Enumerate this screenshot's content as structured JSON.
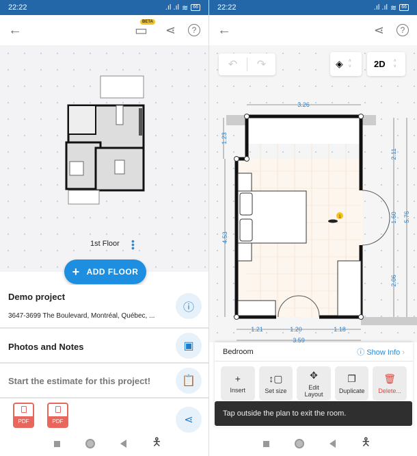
{
  "status_bar": {
    "time": "22:22",
    "battery": "66"
  },
  "left": {
    "beta_badge": "BETA",
    "floor_label": "1st Floor",
    "add_floor_label": "ADD FLOOR",
    "project": {
      "title": "Demo project",
      "address": "3647-3699 The Boulevard, Montréal, Québec, ..."
    },
    "photos_label": "Photos and Notes",
    "estimate_label": "Start the estimate for this project!",
    "pdf_labels": [
      "PDF",
      "PDF"
    ]
  },
  "right": {
    "view_mode": "2D",
    "dimensions": {
      "top": "3.26",
      "left_upper": "1.23",
      "left": "4.53",
      "right_upper": "2.11",
      "right_door": "1.60",
      "right_lower": "2.06",
      "right_total": "5.76",
      "bottom_left": "1.21",
      "bottom_door": "1.20",
      "bottom_right": "1.18",
      "bottom_total": "3.59"
    },
    "marker_badge": "1",
    "room_name": "Bedroom",
    "show_info": "Show Info",
    "actions": [
      {
        "label": "Insert",
        "icon": "plus-icon"
      },
      {
        "label": "Set size",
        "icon": "resize-icon"
      },
      {
        "label": "Edit Layout",
        "icon": "move-icon"
      },
      {
        "label": "Duplicate",
        "icon": "copy-icon"
      },
      {
        "label": "Delete...",
        "icon": "trash-icon"
      }
    ],
    "toast": "Tap outside the plan to exit the room.",
    "colors": {
      "accent": "#1d8ee0",
      "delete": "#e0453a",
      "status_bar": "#2467a8"
    }
  }
}
